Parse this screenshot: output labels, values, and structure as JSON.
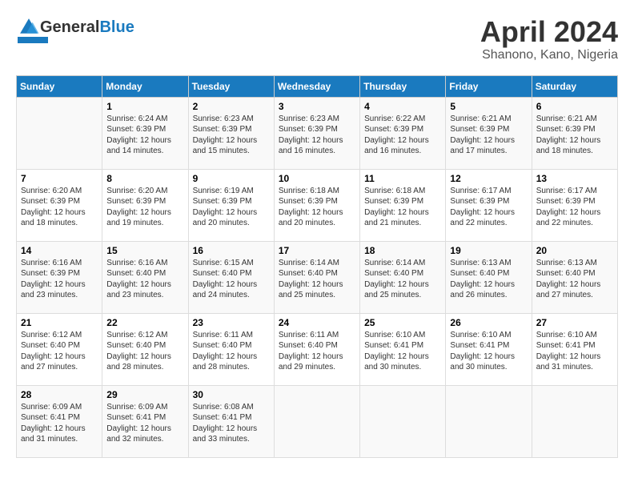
{
  "header": {
    "logo_general": "General",
    "logo_blue": "Blue",
    "month_title": "April 2024",
    "location": "Shanono, Kano, Nigeria"
  },
  "days_of_week": [
    "Sunday",
    "Monday",
    "Tuesday",
    "Wednesday",
    "Thursday",
    "Friday",
    "Saturday"
  ],
  "weeks": [
    [
      {
        "day": "",
        "info": ""
      },
      {
        "day": "1",
        "info": "Sunrise: 6:24 AM\nSunset: 6:39 PM\nDaylight: 12 hours\nand 14 minutes."
      },
      {
        "day": "2",
        "info": "Sunrise: 6:23 AM\nSunset: 6:39 PM\nDaylight: 12 hours\nand 15 minutes."
      },
      {
        "day": "3",
        "info": "Sunrise: 6:23 AM\nSunset: 6:39 PM\nDaylight: 12 hours\nand 16 minutes."
      },
      {
        "day": "4",
        "info": "Sunrise: 6:22 AM\nSunset: 6:39 PM\nDaylight: 12 hours\nand 16 minutes."
      },
      {
        "day": "5",
        "info": "Sunrise: 6:21 AM\nSunset: 6:39 PM\nDaylight: 12 hours\nand 17 minutes."
      },
      {
        "day": "6",
        "info": "Sunrise: 6:21 AM\nSunset: 6:39 PM\nDaylight: 12 hours\nand 18 minutes."
      }
    ],
    [
      {
        "day": "7",
        "info": "Sunrise: 6:20 AM\nSunset: 6:39 PM\nDaylight: 12 hours\nand 18 minutes."
      },
      {
        "day": "8",
        "info": "Sunrise: 6:20 AM\nSunset: 6:39 PM\nDaylight: 12 hours\nand 19 minutes."
      },
      {
        "day": "9",
        "info": "Sunrise: 6:19 AM\nSunset: 6:39 PM\nDaylight: 12 hours\nand 20 minutes."
      },
      {
        "day": "10",
        "info": "Sunrise: 6:18 AM\nSunset: 6:39 PM\nDaylight: 12 hours\nand 20 minutes."
      },
      {
        "day": "11",
        "info": "Sunrise: 6:18 AM\nSunset: 6:39 PM\nDaylight: 12 hours\nand 21 minutes."
      },
      {
        "day": "12",
        "info": "Sunrise: 6:17 AM\nSunset: 6:39 PM\nDaylight: 12 hours\nand 22 minutes."
      },
      {
        "day": "13",
        "info": "Sunrise: 6:17 AM\nSunset: 6:39 PM\nDaylight: 12 hours\nand 22 minutes."
      }
    ],
    [
      {
        "day": "14",
        "info": "Sunrise: 6:16 AM\nSunset: 6:39 PM\nDaylight: 12 hours\nand 23 minutes."
      },
      {
        "day": "15",
        "info": "Sunrise: 6:16 AM\nSunset: 6:40 PM\nDaylight: 12 hours\nand 23 minutes."
      },
      {
        "day": "16",
        "info": "Sunrise: 6:15 AM\nSunset: 6:40 PM\nDaylight: 12 hours\nand 24 minutes."
      },
      {
        "day": "17",
        "info": "Sunrise: 6:14 AM\nSunset: 6:40 PM\nDaylight: 12 hours\nand 25 minutes."
      },
      {
        "day": "18",
        "info": "Sunrise: 6:14 AM\nSunset: 6:40 PM\nDaylight: 12 hours\nand 25 minutes."
      },
      {
        "day": "19",
        "info": "Sunrise: 6:13 AM\nSunset: 6:40 PM\nDaylight: 12 hours\nand 26 minutes."
      },
      {
        "day": "20",
        "info": "Sunrise: 6:13 AM\nSunset: 6:40 PM\nDaylight: 12 hours\nand 27 minutes."
      }
    ],
    [
      {
        "day": "21",
        "info": "Sunrise: 6:12 AM\nSunset: 6:40 PM\nDaylight: 12 hours\nand 27 minutes."
      },
      {
        "day": "22",
        "info": "Sunrise: 6:12 AM\nSunset: 6:40 PM\nDaylight: 12 hours\nand 28 minutes."
      },
      {
        "day": "23",
        "info": "Sunrise: 6:11 AM\nSunset: 6:40 PM\nDaylight: 12 hours\nand 28 minutes."
      },
      {
        "day": "24",
        "info": "Sunrise: 6:11 AM\nSunset: 6:40 PM\nDaylight: 12 hours\nand 29 minutes."
      },
      {
        "day": "25",
        "info": "Sunrise: 6:10 AM\nSunset: 6:41 PM\nDaylight: 12 hours\nand 30 minutes."
      },
      {
        "day": "26",
        "info": "Sunrise: 6:10 AM\nSunset: 6:41 PM\nDaylight: 12 hours\nand 30 minutes."
      },
      {
        "day": "27",
        "info": "Sunrise: 6:10 AM\nSunset: 6:41 PM\nDaylight: 12 hours\nand 31 minutes."
      }
    ],
    [
      {
        "day": "28",
        "info": "Sunrise: 6:09 AM\nSunset: 6:41 PM\nDaylight: 12 hours\nand 31 minutes."
      },
      {
        "day": "29",
        "info": "Sunrise: 6:09 AM\nSunset: 6:41 PM\nDaylight: 12 hours\nand 32 minutes."
      },
      {
        "day": "30",
        "info": "Sunrise: 6:08 AM\nSunset: 6:41 PM\nDaylight: 12 hours\nand 33 minutes."
      },
      {
        "day": "",
        "info": ""
      },
      {
        "day": "",
        "info": ""
      },
      {
        "day": "",
        "info": ""
      },
      {
        "day": "",
        "info": ""
      }
    ]
  ]
}
